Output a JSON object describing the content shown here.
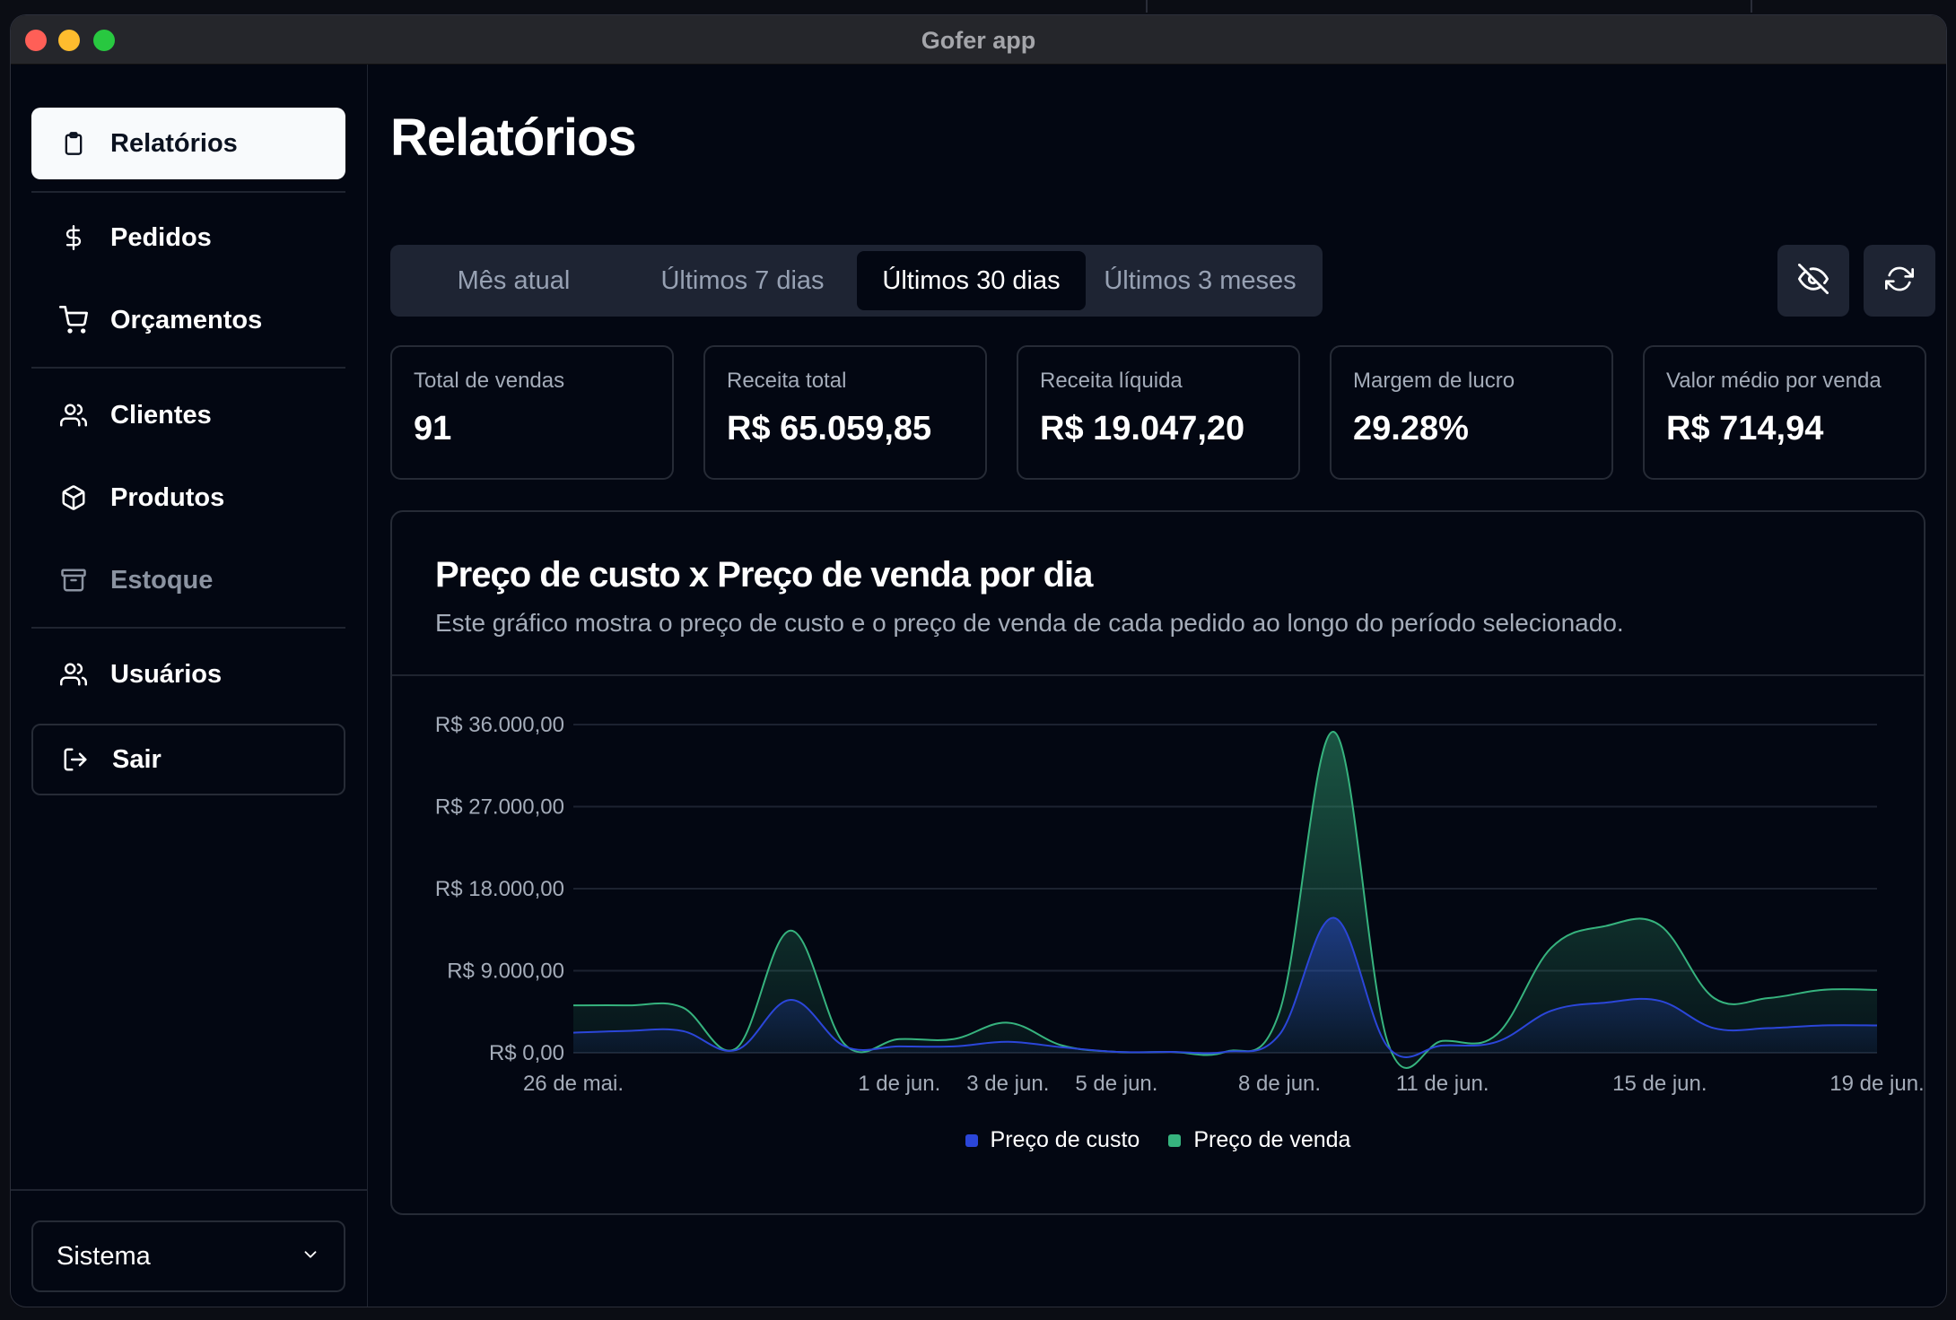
{
  "window": {
    "title": "Gofer app"
  },
  "sidebar": {
    "items": [
      {
        "label": "Relatórios",
        "icon": "clipboard-icon",
        "state": "active"
      },
      {
        "label": "Pedidos",
        "icon": "dollar-icon"
      },
      {
        "label": "Orçamentos",
        "icon": "cart-icon"
      },
      {
        "label": "Clientes",
        "icon": "users-icon"
      },
      {
        "label": "Produtos",
        "icon": "box-icon"
      },
      {
        "label": "Estoque",
        "icon": "archive-icon",
        "state": "disabled"
      },
      {
        "label": "Usuários",
        "icon": "users-icon"
      },
      {
        "label": "Sair",
        "icon": "logout-icon"
      }
    ],
    "theme_select": {
      "value": "Sistema",
      "icon": "chevron-down-icon"
    }
  },
  "main": {
    "title": "Relatórios",
    "tabs": [
      {
        "label": "Mês atual"
      },
      {
        "label": "Últimos 7 dias"
      },
      {
        "label": "Últimos 30 dias",
        "selected": true
      },
      {
        "label": "Últimos 3 meses"
      }
    ],
    "actions": [
      {
        "icon": "eye-off-icon"
      },
      {
        "icon": "refresh-icon"
      }
    ],
    "stats": [
      {
        "label": "Total de vendas",
        "value": "91"
      },
      {
        "label": "Receita total",
        "value": "R$ 65.059,85"
      },
      {
        "label": "Receita líquida",
        "value": "R$ 19.047,20"
      },
      {
        "label": "Margem de lucro",
        "value": "29.28%"
      },
      {
        "label": "Valor médio por venda",
        "value": "R$ 714,94"
      }
    ],
    "chart_card": {
      "title": "Preço de custo x Preço de venda por dia",
      "description": "Este gráfico mostra o preço de custo e o preço de venda de cada pedido ao longo do período selecionado."
    }
  },
  "colors": {
    "cost": "#2b46d9",
    "sale": "#36b37e",
    "background": "#030712"
  },
  "chart_data": {
    "type": "area",
    "x": [
      "26 de mai.",
      "27 de mai.",
      "28 de mai.",
      "29 de mai.",
      "30 de mai.",
      "31 de mai.",
      "1 de jun.",
      "2 de jun.",
      "3 de jun.",
      "4 de jun.",
      "5 de jun.",
      "6 de jun.",
      "7 de jun.",
      "8 de jun.",
      "9 de jun.",
      "10 de jun.",
      "11 de jun.",
      "12 de jun.",
      "13 de jun.",
      "14 de jun.",
      "15 de jun.",
      "16 de jun.",
      "17 de jun.",
      "18 de jun.",
      "19 de jun."
    ],
    "x_tick_labels": [
      "26 de mai.",
      "1 de jun.",
      "3 de jun.",
      "5 de jun.",
      "8 de jun.",
      "11 de jun.",
      "15 de jun.",
      "19 de jun."
    ],
    "y_ticks": [
      0,
      9000,
      18000,
      27000,
      36000
    ],
    "y_tick_labels": [
      "R$ 0,00",
      "R$ 9.000,00",
      "R$ 18.000,00",
      "R$ 27.000,00",
      "R$ 36.000,00"
    ],
    "ylim": [
      0,
      36000
    ],
    "series": [
      {
        "name": "Preço de custo",
        "values": [
          2200,
          2400,
          2400,
          300,
          5800,
          700,
          700,
          700,
          1200,
          600,
          100,
          100,
          100,
          2000,
          14800,
          600,
          800,
          1200,
          4600,
          5500,
          5700,
          2700,
          2700,
          3000,
          3000
        ]
      },
      {
        "name": "Preço de venda",
        "values": [
          5200,
          5200,
          5000,
          500,
          13400,
          900,
          1500,
          1500,
          3300,
          800,
          100,
          100,
          100,
          4500,
          35200,
          1000,
          1300,
          2000,
          11500,
          13900,
          14000,
          6000,
          6000,
          6900,
          6900
        ]
      }
    ],
    "legend": [
      "Preço de custo",
      "Preço de venda"
    ],
    "legend_position": "bottom-center",
    "grid": true
  }
}
